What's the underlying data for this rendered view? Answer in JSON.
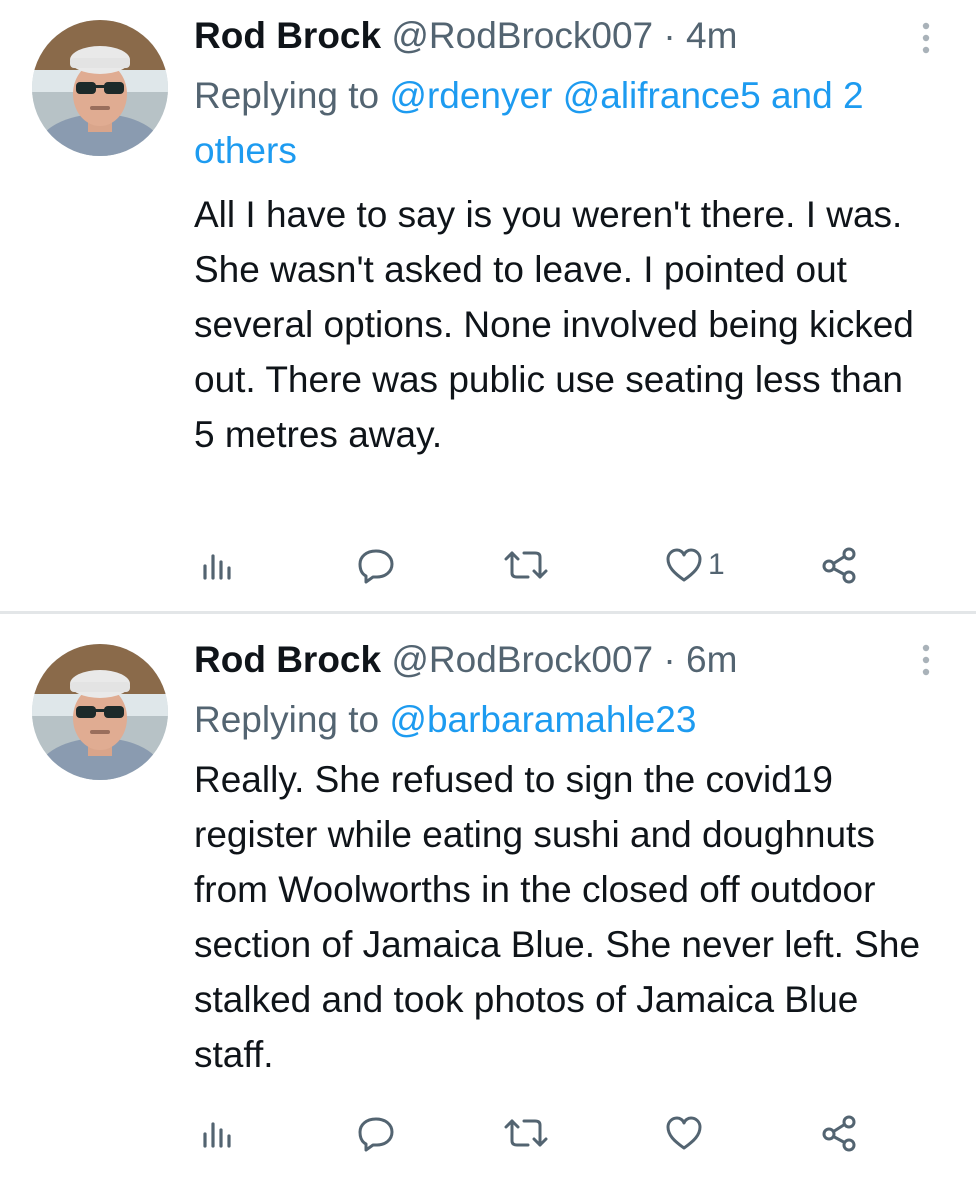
{
  "tweets": [
    {
      "author": {
        "name": "Rod Brock",
        "handle": "@RodBrock007",
        "avatar_icon": "profile-photo"
      },
      "separator": "·",
      "time": "4m",
      "reply": {
        "prefix": "Replying to",
        "mentions": [
          "@rdenyer",
          "@alifrance5",
          "and 2 others"
        ]
      },
      "text": "All I have to say is you weren't there. I was. She wasn't asked to leave. I pointed out several options. None involved being kicked out. There was public use seating less than 5 metres away.",
      "actions": {
        "views_icon": "views-icon",
        "reply_icon": "reply-icon",
        "retweet_icon": "retweet-icon",
        "like_icon": "heart-icon",
        "like_count": "1",
        "share_icon": "share-icon"
      }
    },
    {
      "author": {
        "name": "Rod Brock",
        "handle": "@RodBrock007",
        "avatar_icon": "profile-photo"
      },
      "separator": "·",
      "time": "6m",
      "reply": {
        "prefix": "Replying to",
        "mentions": [
          "@barbaramahle23"
        ]
      },
      "text": "Really. She refused to sign the covid19 register while eating sushi and doughnuts from Woolworths in the closed off outdoor section of Jamaica Blue. She never left. She stalked and took photos of Jamaica Blue staff.",
      "actions": {
        "views_icon": "views-icon",
        "reply_icon": "reply-icon",
        "retweet_icon": "retweet-icon",
        "like_icon": "heart-icon",
        "like_count": "",
        "share_icon": "share-icon"
      }
    }
  ],
  "colors": {
    "text": "#0f1419",
    "secondary": "#536471",
    "link": "#1d9bf0",
    "divider": "#e3e6e8"
  }
}
